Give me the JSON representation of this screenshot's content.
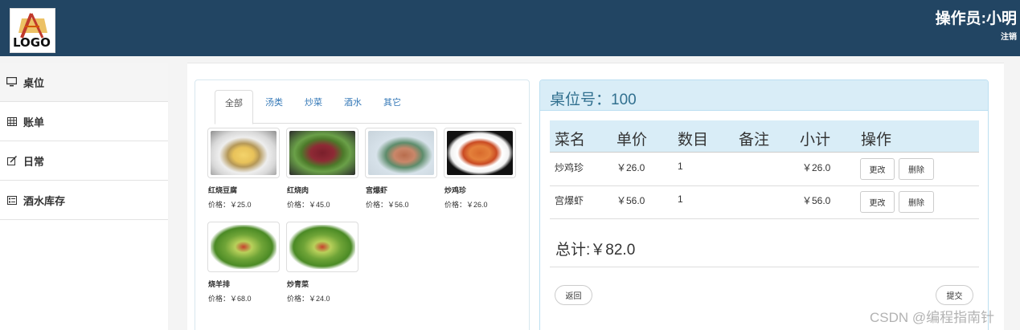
{
  "header": {
    "logo_text": "LOGO",
    "operator": "操作员:小明",
    "logout": "注销",
    "bg_color": "#224563"
  },
  "sidebar": {
    "items": [
      {
        "label": "桌位",
        "icon": "monitor-icon",
        "active": true
      },
      {
        "label": "账单",
        "icon": "table-icon",
        "active": false
      },
      {
        "label": "日常",
        "icon": "edit-icon",
        "active": false
      },
      {
        "label": "酒水库存",
        "icon": "list-icon",
        "active": false
      }
    ]
  },
  "menu": {
    "tabs": [
      "全部",
      "汤类",
      "炒菜",
      "酒水",
      "其它"
    ],
    "active_tab": "全部",
    "dishes": [
      {
        "name": "红烧豆腐",
        "price": "价格：￥25.0"
      },
      {
        "name": "红烧肉",
        "price": "价格：￥45.0"
      },
      {
        "name": "宫爆虾",
        "price": "价格：￥56.0"
      },
      {
        "name": "炒鸡珍",
        "price": "价格：￥26.0"
      },
      {
        "name": "烧羊排",
        "price": "价格：￥68.0"
      },
      {
        "name": "炒青菜",
        "price": "价格：￥24.0"
      }
    ]
  },
  "order": {
    "title": "桌位号：100",
    "columns": [
      "菜名",
      "单价",
      "数目",
      "备注",
      "小计",
      "操作"
    ],
    "rows": [
      {
        "name": "炒鸡珍",
        "price": "￥26.0",
        "qty": "1",
        "note": "",
        "subtotal": "￥26.0",
        "edit": "更改",
        "delete": "删除"
      },
      {
        "name": "宫爆虾",
        "price": "￥56.0",
        "qty": "1",
        "note": "",
        "subtotal": "￥56.0",
        "edit": "更改",
        "delete": "删除"
      }
    ],
    "total": "总计:￥82.0",
    "back_label": "返回",
    "submit_label": "提交"
  },
  "watermark": "CSDN @编程指南针"
}
